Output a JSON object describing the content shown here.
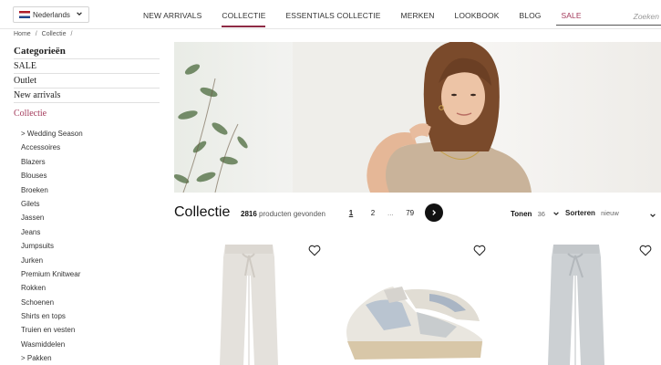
{
  "header": {
    "language": {
      "label": "Nederlands",
      "flag_icon": "netherlands-flag-icon"
    },
    "nav": [
      {
        "label": "NEW ARRIVALS",
        "active": false
      },
      {
        "label": "COLLECTIE",
        "active": true
      },
      {
        "label": "ESSENTIALS COLLECTIE",
        "active": false
      },
      {
        "label": "MERKEN",
        "active": false
      },
      {
        "label": "LOOKBOOK",
        "active": false
      },
      {
        "label": "BLOG",
        "active": false
      },
      {
        "label": "SALE",
        "active": false
      }
    ],
    "search": {
      "placeholder": "Zoeken",
      "value": ""
    }
  },
  "breadcrumb": [
    "Home",
    "Collectie",
    "/"
  ],
  "sidebar": {
    "title": "Categorieën",
    "main_items": [
      "SALE",
      "Outlet",
      "New arrivals"
    ],
    "active_item": "Collectie",
    "sub_items": [
      "> Wedding Season",
      "Accessoires",
      "Blazers",
      "Blouses",
      "Broeken",
      "Gilets",
      "Jassen",
      "Jeans",
      "Jumpsuits",
      "Jurken",
      "Premium Knitwear",
      "Rokken",
      "Schoenen",
      "Shirts en tops",
      "Truien en vesten",
      "Wasmiddelen",
      "> Pakken"
    ]
  },
  "listing": {
    "title": "Collectie",
    "count": "2816",
    "count_suffix": "producten gevonden",
    "pages": [
      "1",
      "2",
      "...",
      "79"
    ],
    "current_page": "1",
    "show_label": "Tonen",
    "show_value": "36",
    "sort_label": "Sorteren",
    "sort_value": "nieuw"
  },
  "colors": {
    "accent": "#8e2a45",
    "sale": "#a3395a",
    "pager_next": "#111111"
  }
}
